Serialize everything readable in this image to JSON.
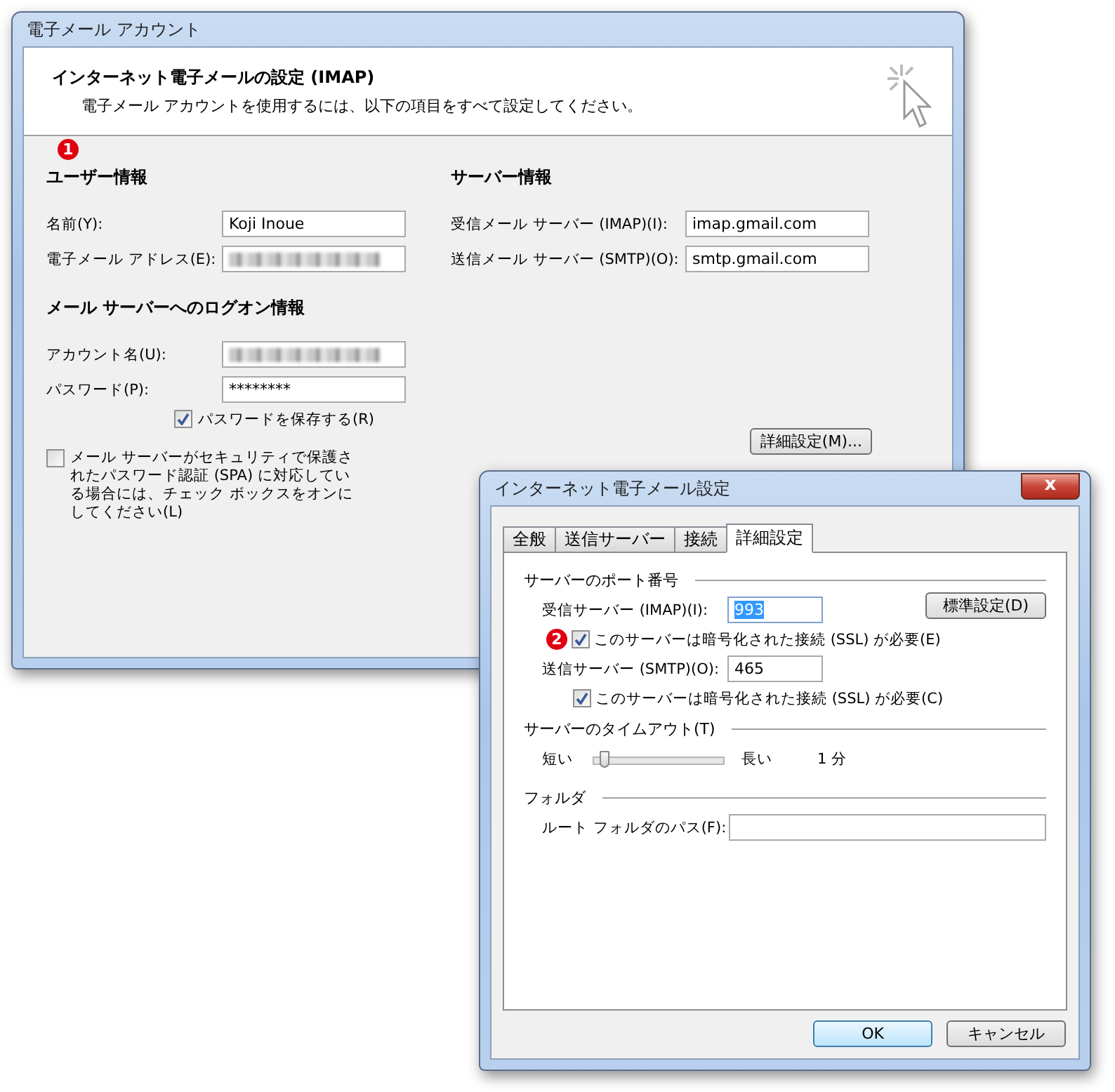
{
  "account_window": {
    "title": "電子メール アカウント",
    "heading": "インターネット電子メールの設定 (IMAP)",
    "subheading": "電子メール アカウントを使用するには、以下の項目をすべて設定してください。",
    "marker": "1",
    "user_info": {
      "title": "ユーザー情報",
      "fields": [
        {
          "label": "名前(Y):",
          "kind": "text",
          "value": "Koji Inoue"
        },
        {
          "label": "電子メール アドレス(E):",
          "kind": "blurred"
        }
      ]
    },
    "logon_info": {
      "title": "メール サーバーへのログオン情報",
      "fields": [
        {
          "label": "アカウント名(U):",
          "kind": "blurred"
        },
        {
          "label": "パスワード(P):",
          "kind": "text",
          "value": "********"
        }
      ]
    },
    "save_password": {
      "label": "パスワードを保存する(R)",
      "checked": true
    },
    "spa": {
      "label": "メール サーバーがセキュリティで保護されたパスワード認証 (SPA) に対応している場合には、チェック ボックスをオンにしてください(L)",
      "checked": false
    },
    "server_info": {
      "title": "サーバー情報",
      "fields": [
        {
          "label": "受信メール サーバー (IMAP)(I):",
          "kind": "text",
          "value": "imap.gmail.com"
        },
        {
          "label": "送信メール サーバー (SMTP)(O):",
          "kind": "text",
          "value": "smtp.gmail.com"
        }
      ]
    },
    "more_settings_button": "詳細設定(M)..."
  },
  "settings_window": {
    "title": "インターネット電子メール設定",
    "close": "x",
    "tabs": [
      {
        "label": "全般",
        "selected": false
      },
      {
        "label": "送信サーバー",
        "selected": false
      },
      {
        "label": "接続",
        "selected": false
      },
      {
        "label": "詳細設定",
        "selected": true
      }
    ],
    "ports": {
      "title": "サーバーのポート番号",
      "incoming": {
        "label": "受信サーバー (IMAP)(I):",
        "value": "993",
        "highlighted": true
      },
      "default_button": "標準設定(D)",
      "marker": "2",
      "incoming_ssl": {
        "label": "このサーバーは暗号化された接続 (SSL) が必要(E)",
        "checked": true
      },
      "outgoing": {
        "label": "送信サーバー (SMTP)(O):",
        "value": "465",
        "highlighted": false
      },
      "outgoing_ssl": {
        "label": "このサーバーは暗号化された接続 (SSL) が必要(C)",
        "checked": true
      }
    },
    "timeout": {
      "title": "サーバーのタイムアウト(T)",
      "short_label": "短い",
      "long_label": "長い",
      "level": 0.1,
      "reading": "1 分"
    },
    "folders": {
      "title": "フォルダ",
      "root_label": "ルート フォルダのパス(F):"
    },
    "buttons": [
      "OK",
      "キャンセル"
    ]
  }
}
